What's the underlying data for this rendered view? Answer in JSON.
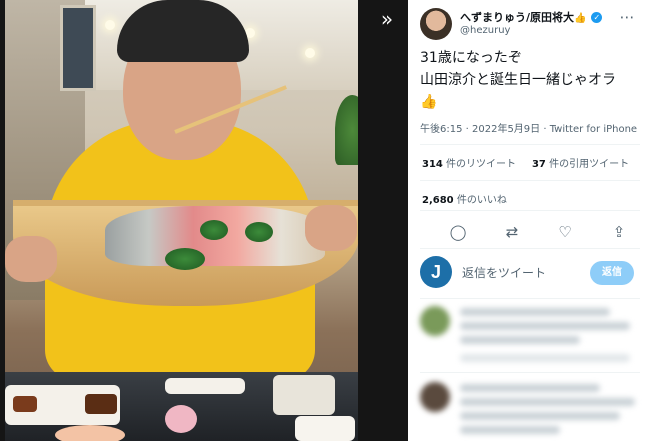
{
  "media": {
    "expand_icon": "double-chevron-right-icon",
    "expand_glyph": "»"
  },
  "tweet": {
    "display_name": "へずまりゅう/原田将大",
    "name_emoji": "👍",
    "verified_glyph": "✓",
    "handle": "@hezuruy",
    "more_glyph": "⋯",
    "text_lines": [
      "31歳になったぞ",
      "山田涼介と誕生日一緒じゃオラ",
      "👍"
    ],
    "meta": "午後6:15 · 2022年5月9日 · Twitter for iPhone",
    "retweets": {
      "count": "314",
      "label": " 件のリツイート"
    },
    "quotes": {
      "count": "37",
      "label": " 件の引用ツイート"
    },
    "likes": {
      "count": "2,680",
      "label": " 件のいいね"
    },
    "actions": [
      {
        "name": "reply-icon",
        "glyph": "◯"
      },
      {
        "name": "retweet-icon",
        "glyph": "⇄"
      },
      {
        "name": "like-icon",
        "glyph": "♡"
      },
      {
        "name": "share-icon",
        "glyph": "⇪"
      }
    ]
  },
  "compose": {
    "avatar_letter": "J",
    "placeholder": "返信をツイート",
    "button_label": "返信"
  },
  "colors": {
    "accent": "#1d9bf0",
    "reply_button": "#8ecdf8",
    "shirt": "#f2c21a"
  }
}
